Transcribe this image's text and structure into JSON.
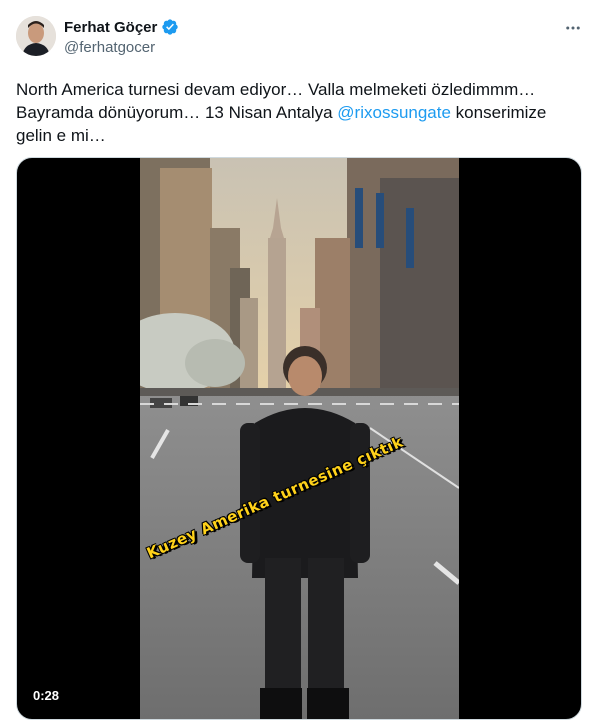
{
  "author": {
    "display_name": "Ferhat Göçer",
    "handle": "@ferhatgocer"
  },
  "tweet": {
    "text_before": "North America turnesi devam ediyor… Valla melmeketi özledimmm… Bayramda dönüyorum… 13 Nisan Antalya ",
    "mention": "@rixossungate",
    "text_after": " konserimize gelin e mi…"
  },
  "video": {
    "duration": "0:28",
    "overlay_caption": "Kuzey Amerika turnesine çıktık"
  },
  "colors": {
    "link": "#1d9bf0",
    "verified_badge": "#1d9bf0",
    "caption_text": "#ffd21a"
  },
  "icons": {
    "verified": "verified-badge-icon",
    "more": "more-horizontal-icon"
  }
}
